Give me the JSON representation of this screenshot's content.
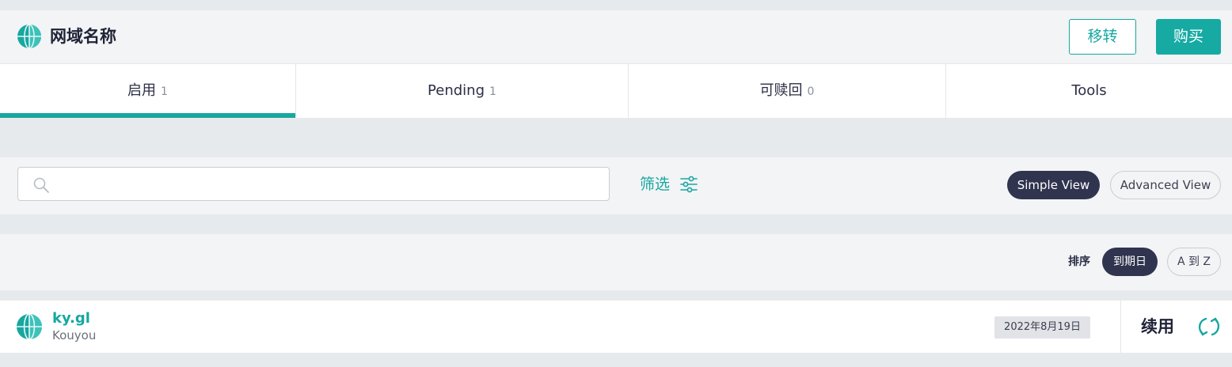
{
  "header": {
    "title": "网域名称",
    "transfer_label": "移转",
    "buy_label": "购买"
  },
  "tabs": [
    {
      "label": "启用",
      "count": "1",
      "active": true
    },
    {
      "label": "Pending",
      "count": "1",
      "active": false
    },
    {
      "label": "可赎回",
      "count": "0",
      "active": false
    },
    {
      "label": "Tools",
      "count": "",
      "active": false
    }
  ],
  "search": {
    "placeholder": "",
    "value": ""
  },
  "filter": {
    "label": "筛选"
  },
  "views": {
    "simple_label": "Simple View",
    "advanced_label": "Advanced View",
    "selected": "simple"
  },
  "sort": {
    "label": "排序",
    "options": [
      "到期日",
      "A 到 Z"
    ],
    "selected": "到期日"
  },
  "domains": [
    {
      "name": "ky.gl",
      "owner": "Kouyou",
      "expiry": "2022年8月19日",
      "renew_label": "续用"
    }
  ],
  "colors": {
    "accent": "#16aaa3",
    "dark_pill": "#30344f",
    "background": "#e7eaed"
  },
  "icons": {
    "logo": "globe-icon",
    "search": "search-icon",
    "filter": "sliders-icon",
    "renew": "refresh-icon"
  }
}
